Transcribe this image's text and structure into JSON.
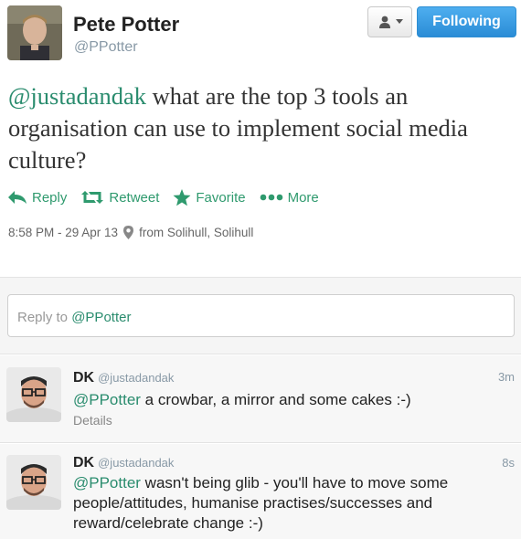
{
  "profile": {
    "name": "Pete Potter",
    "handle": "@PPotter",
    "follow_label": "Following"
  },
  "tweet": {
    "mention": "@justadandak",
    "text": " what are the top 3 tools an organisation can use to implement social media culture?",
    "actions": {
      "reply": "Reply",
      "retweet": "Retweet",
      "favorite": "Favorite",
      "more": "More"
    },
    "timestamp": "8:58 PM - 29 Apr 13",
    "location": "from Solihull, Solihull"
  },
  "reply_box": {
    "prefix": "Reply to ",
    "mention": "@PPotter"
  },
  "replies": [
    {
      "name": "DK",
      "handle": "@justadandak",
      "time": "3m",
      "mention": "@PPotter",
      "text": " a crowbar, a mirror and some cakes :-)",
      "details": "Details"
    },
    {
      "name": "DK",
      "handle": "@justadandak",
      "time": "8s",
      "mention": "@PPotter",
      "text": " wasn't being glib - you'll have to move some people/attitudes, humanise practises/successes and reward/celebrate change :-)"
    }
  ],
  "colors": {
    "accent_green": "#2a8c6e",
    "follow_blue": "#2a8cd6",
    "muted": "#8899a6"
  }
}
